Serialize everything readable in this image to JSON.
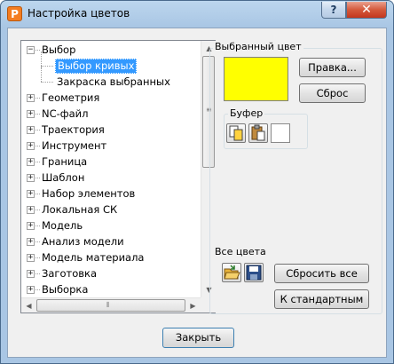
{
  "window": {
    "title": "Настройка цветов",
    "help_glyph": "?",
    "close_glyph": "✕",
    "app_glyph": "P"
  },
  "tree": {
    "items": [
      {
        "label": "Выбор",
        "level": 0,
        "expanded": true
      },
      {
        "label": "Выбор кривых",
        "level": 1,
        "selected": true
      },
      {
        "label": "Закраска выбранных",
        "level": 1
      },
      {
        "label": "Геометрия",
        "level": 0
      },
      {
        "label": "NC-файл",
        "level": 0
      },
      {
        "label": "Траектория",
        "level": 0
      },
      {
        "label": "Инструмент",
        "level": 0
      },
      {
        "label": "Граница",
        "level": 0
      },
      {
        "label": "Шаблон",
        "level": 0
      },
      {
        "label": "Набор элементов",
        "level": 0
      },
      {
        "label": "Локальная СК",
        "level": 0
      },
      {
        "label": "Модель",
        "level": 0
      },
      {
        "label": "Анализ модели",
        "level": 0
      },
      {
        "label": "Модель материала",
        "level": 0
      },
      {
        "label": "Заготовка",
        "level": 0
      },
      {
        "label": "Выборка",
        "level": 0
      }
    ]
  },
  "selected_color": {
    "group_label": "Выбранный цвет",
    "swatch_color": "#ffff00",
    "edit_button": "Правка...",
    "reset_button": "Сброс"
  },
  "buffer": {
    "group_label": "Буфер",
    "icons": [
      "copy-icon",
      "paste-icon",
      "empty-slot"
    ]
  },
  "all_colors": {
    "group_label": "Все цвета",
    "icons": [
      "open-folder-icon",
      "save-icon"
    ],
    "reset_all_button": "Сбросить все",
    "defaults_button": "К стандартным"
  },
  "close_button": "Закрыть"
}
